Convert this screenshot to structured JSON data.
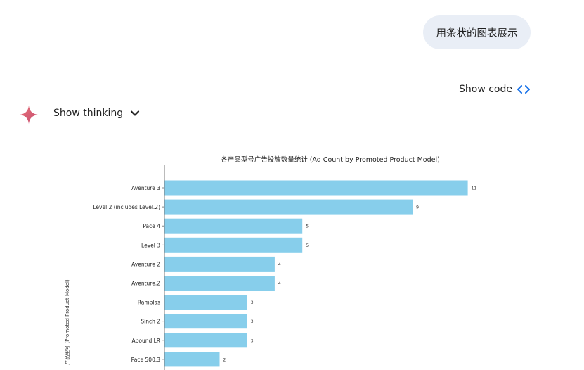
{
  "user_message": {
    "text": "用条状的图表展示"
  },
  "toolbar": {
    "show_code_label": "Show code",
    "code_icon": "code-brackets-icon"
  },
  "assistant": {
    "spark_icon": "gemini-spark-icon",
    "show_thinking_label": "Show thinking",
    "chevron_icon": "chevron-down-icon"
  },
  "colors": {
    "bar": "#87ceeb",
    "spark_top": "#e8737a",
    "spark_bottom": "#c64b6e",
    "code_icon": "#1a73e8",
    "bubble": "#e9eef6"
  },
  "chart_data": {
    "type": "bar",
    "orientation": "horizontal",
    "title": "各产品型号广告投放数量统计 (Ad Count by Promoted Product Model)",
    "ylabel": "产品型号 (Promoted Product Model)",
    "xlabel": "",
    "xlim": [
      0,
      11.8
    ],
    "grid": false,
    "categories": [
      "Aventure 3",
      "Level 2 (includes Level.2)",
      "Pace 4",
      "Level 3",
      "Aventure 2",
      "Aventure.2",
      "Ramblas",
      "Sinch 2",
      "Abound LR",
      "Pace 500.3"
    ],
    "values": [
      11,
      9,
      5,
      5,
      4,
      4,
      3,
      3,
      3,
      2
    ],
    "value_labels": [
      "11",
      "9",
      "5",
      "5",
      "4",
      "4",
      "3",
      "3",
      "3",
      "2"
    ]
  }
}
